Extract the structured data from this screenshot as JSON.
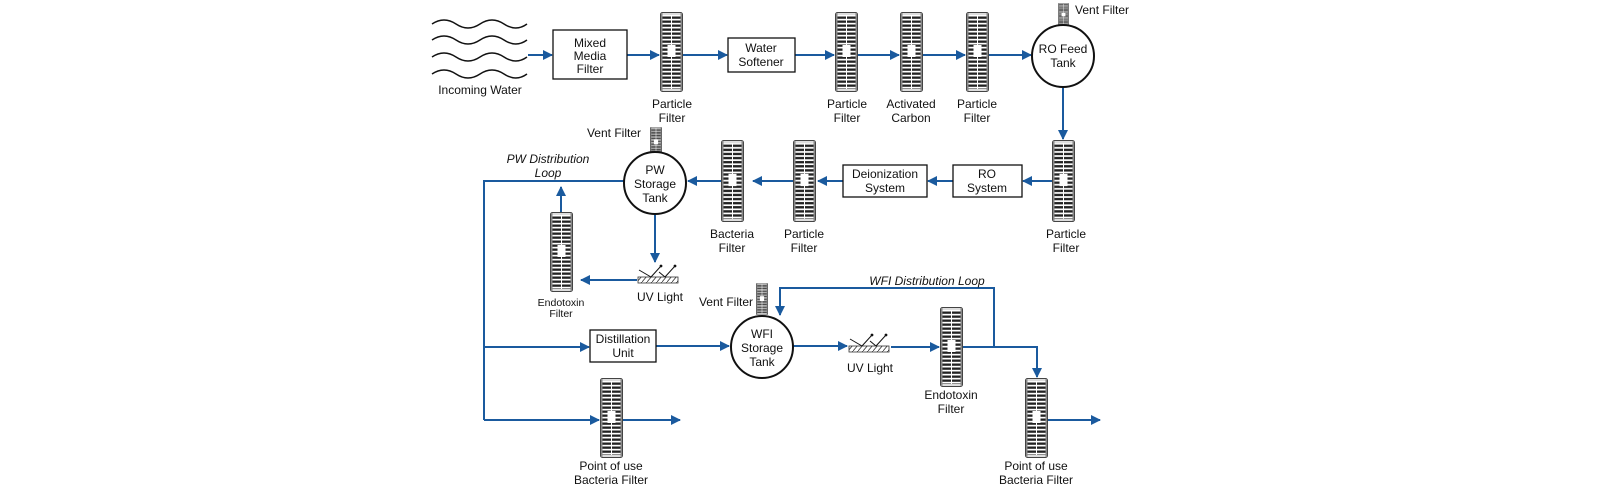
{
  "colors": {
    "flow": "#1a5a9e",
    "outline": "#111111"
  },
  "icons": {
    "filter": "filter-cartridge-icon",
    "uv": "uv-lamp-icon",
    "water": "water-waves-icon"
  },
  "labels": {
    "incoming_water": "Incoming Water",
    "mixed_media": [
      "Mixed",
      "Media",
      "Filter"
    ],
    "particle_filter": [
      "Particle",
      "Filter"
    ],
    "water_softener": [
      "Water",
      "Softener"
    ],
    "activated_carbon": [
      "Activated",
      "Carbon"
    ],
    "ro_feed_tank": [
      "RO Feed",
      "Tank"
    ],
    "vent_filter": "Vent Filter",
    "ro_system": [
      "RO",
      "System"
    ],
    "deionization": [
      "Deionization",
      "System"
    ],
    "bacteria_filter": [
      "Bacteria",
      "Filter"
    ],
    "pw_tank": [
      "PW",
      "Storage",
      "Tank"
    ],
    "pw_loop": [
      "PW Distribution",
      "Loop"
    ],
    "endotoxin_filter": [
      "Endotoxin",
      "Filter"
    ],
    "uv_light": "UV Light",
    "distillation": [
      "Distillation",
      "Unit"
    ],
    "wfi_tank": [
      "WFI",
      "Storage",
      "Tank"
    ],
    "wfi_loop": "WFI Distribution Loop",
    "pou_filter": [
      "Point of use",
      "Bacteria Filter"
    ]
  }
}
